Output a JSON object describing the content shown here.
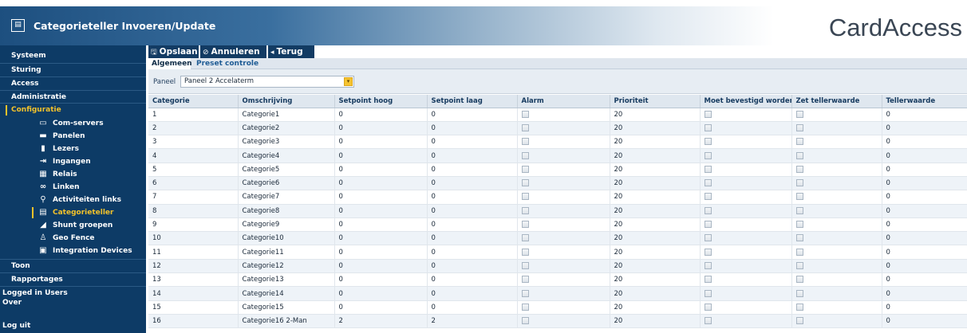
{
  "window": {
    "title": "Categorieteller Invoeren/Update",
    "brand": "CardAccess"
  },
  "sidebar": {
    "top_items": [
      {
        "label": "Systeem"
      },
      {
        "label": "Sturing"
      },
      {
        "label": "Access"
      },
      {
        "label": "Administratie"
      },
      {
        "label": "Configuratie",
        "active": true
      }
    ],
    "sub_items": [
      {
        "label": "Com-servers",
        "icon": "monitor-icon"
      },
      {
        "label": "Panelen",
        "icon": "panel-icon"
      },
      {
        "label": "Lezers",
        "icon": "reader-icon"
      },
      {
        "label": "Ingangen",
        "icon": "input-icon"
      },
      {
        "label": "Relais",
        "icon": "relay-icon"
      },
      {
        "label": "Linken",
        "icon": "link-icon"
      },
      {
        "label": "Activiteiten links",
        "icon": "chain-icon"
      },
      {
        "label": "Categorieteller",
        "icon": "counter-icon",
        "active": true
      },
      {
        "label": "Shunt groepen",
        "icon": "shunt-icon"
      },
      {
        "label": "Geo Fence",
        "icon": "person-pin-icon"
      },
      {
        "label": "Integration Devices",
        "icon": "device-icon"
      }
    ],
    "bottom_items": [
      {
        "label": "Toon"
      },
      {
        "label": "Rapportages"
      },
      {
        "label": "Logged in Users"
      },
      {
        "label": "Over"
      },
      {
        "label": "Log uit"
      }
    ]
  },
  "toolbar": {
    "save": "Opslaan",
    "cancel": "Annuleren",
    "back": "Terug"
  },
  "tabs": [
    {
      "label": "Algemeen",
      "active": true
    },
    {
      "label": "Preset controle",
      "active": false
    }
  ],
  "filter": {
    "label": "Paneel",
    "value": "Paneel 2 Accelaterm"
  },
  "table": {
    "columns": [
      "Categorie",
      "Omschrijving",
      "Setpoint hoog",
      "Setpoint laag",
      "Alarm",
      "Prioriteit",
      "Moet bevestigd worden",
      "Zet tellerwaarde",
      "Tellerwaarde"
    ],
    "rows": [
      {
        "cat": "1",
        "desc": "Categorie1",
        "hi": "0",
        "lo": "0",
        "prio": "20",
        "val": "0"
      },
      {
        "cat": "2",
        "desc": "Categorie2",
        "hi": "0",
        "lo": "0",
        "prio": "20",
        "val": "0"
      },
      {
        "cat": "3",
        "desc": "Categorie3",
        "hi": "0",
        "lo": "0",
        "prio": "20",
        "val": "0"
      },
      {
        "cat": "4",
        "desc": "Categorie4",
        "hi": "0",
        "lo": "0",
        "prio": "20",
        "val": "0"
      },
      {
        "cat": "5",
        "desc": "Categorie5",
        "hi": "0",
        "lo": "0",
        "prio": "20",
        "val": "0"
      },
      {
        "cat": "6",
        "desc": "Categorie6",
        "hi": "0",
        "lo": "0",
        "prio": "20",
        "val": "0"
      },
      {
        "cat": "7",
        "desc": "Categorie7",
        "hi": "0",
        "lo": "0",
        "prio": "20",
        "val": "0"
      },
      {
        "cat": "8",
        "desc": "Categorie8",
        "hi": "0",
        "lo": "0",
        "prio": "20",
        "val": "0"
      },
      {
        "cat": "9",
        "desc": "Categorie9",
        "hi": "0",
        "lo": "0",
        "prio": "20",
        "val": "0"
      },
      {
        "cat": "10",
        "desc": "Categorie10",
        "hi": "0",
        "lo": "0",
        "prio": "20",
        "val": "0"
      },
      {
        "cat": "11",
        "desc": "Categorie11",
        "hi": "0",
        "lo": "0",
        "prio": "20",
        "val": "0"
      },
      {
        "cat": "12",
        "desc": "Categorie12",
        "hi": "0",
        "lo": "0",
        "prio": "20",
        "val": "0"
      },
      {
        "cat": "13",
        "desc": "Categorie13",
        "hi": "0",
        "lo": "0",
        "prio": "20",
        "val": "0"
      },
      {
        "cat": "14",
        "desc": "Categorie14",
        "hi": "0",
        "lo": "0",
        "prio": "20",
        "val": "0"
      },
      {
        "cat": "15",
        "desc": "Categorie15",
        "hi": "0",
        "lo": "0",
        "prio": "20",
        "val": "0"
      },
      {
        "cat": "16",
        "desc": "Categorie16 2-Man",
        "hi": "2",
        "lo": "2",
        "prio": "20",
        "val": "0"
      }
    ]
  }
}
